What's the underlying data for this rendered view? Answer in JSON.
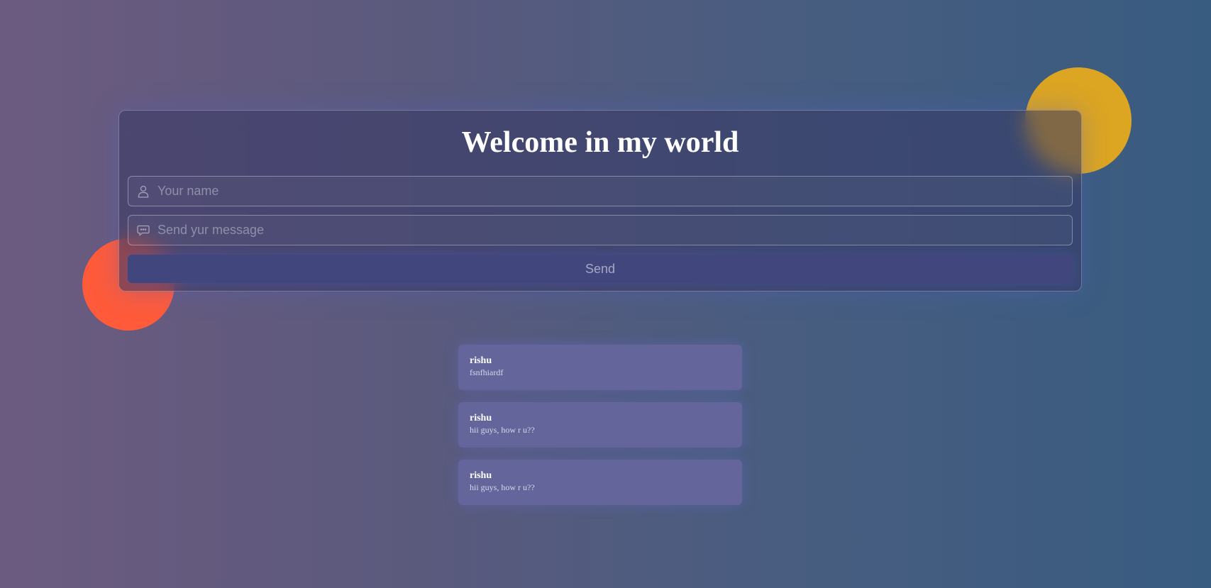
{
  "header": {
    "title": "Welcome in my world"
  },
  "form": {
    "name_placeholder": "Your name",
    "name_icon": "user-icon",
    "message_placeholder": "Send yur message",
    "message_icon": "chat-bubble-icon",
    "send_label": "Send"
  },
  "decorations": {
    "orange_circle_color": "#ff5b3a",
    "yellow_circle_color": "#dca522"
  },
  "messages": [
    {
      "author": "rishu",
      "text": "fsnfhiardf"
    },
    {
      "author": "rishu",
      "text": "hii guys, how r u??"
    },
    {
      "author": "rishu",
      "text": "hii guys, how r u??"
    }
  ]
}
